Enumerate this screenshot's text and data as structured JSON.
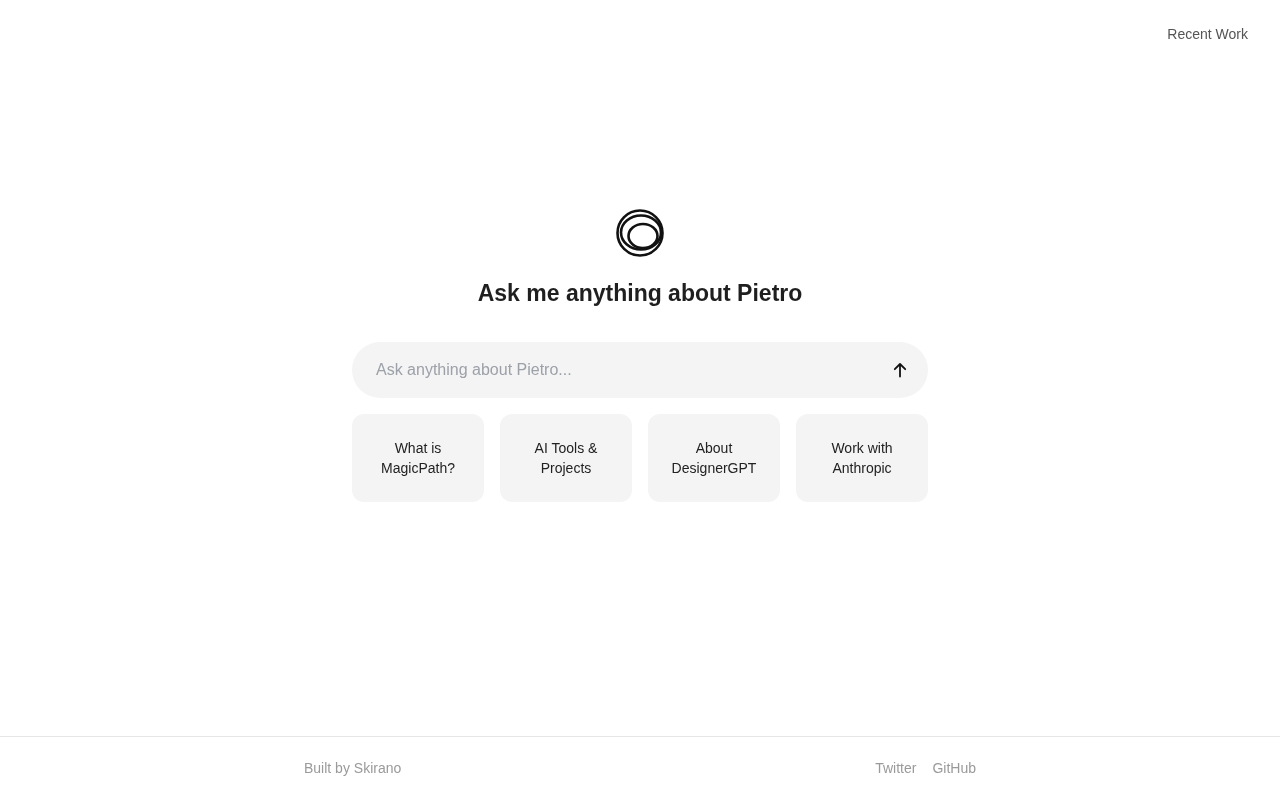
{
  "header": {
    "links": [
      "Recent Work"
    ]
  },
  "hero": {
    "title": "Ask me anything about Pietro"
  },
  "search": {
    "placeholder": "Ask anything about Pietro..."
  },
  "suggestions": [
    "What is MagicPath?",
    "AI Tools & Projects",
    "About DesignerGPT",
    "Work with Anthropic"
  ],
  "footer": {
    "credit": "Built by Skirano",
    "links": [
      "Twitter",
      "GitHub"
    ]
  }
}
